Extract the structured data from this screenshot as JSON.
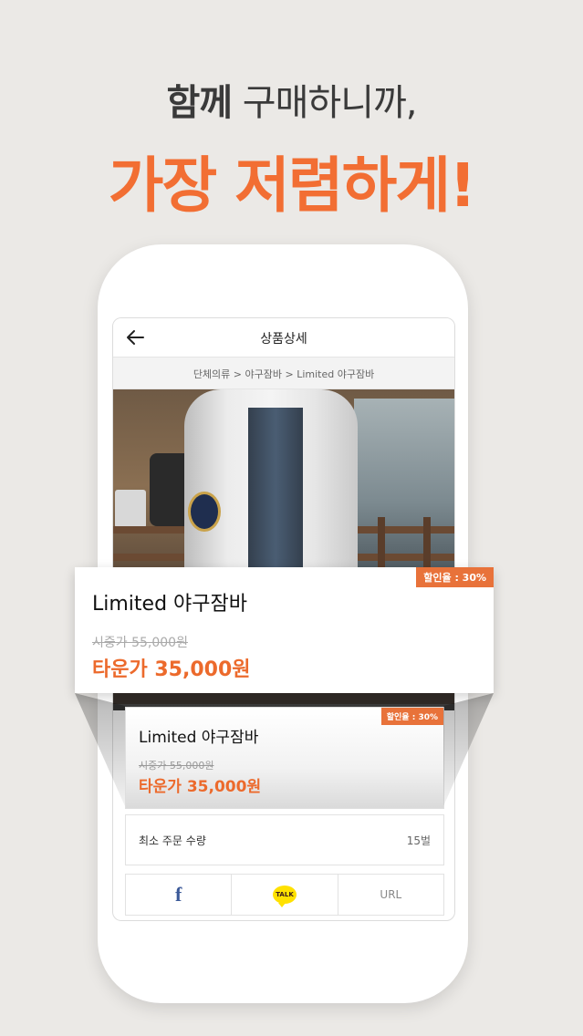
{
  "headline": {
    "line1_bold": "함께",
    "line1_rest": " 구매하니까,",
    "line2": "가장 저렴하게!"
  },
  "nav": {
    "title": "상품상세",
    "back_icon": "arrow-left-icon"
  },
  "breadcrumb": "단체의류 > 야구잠바 > Limited 야구잠바",
  "product": {
    "name": "Limited 야구잠바",
    "discount_badge": "할인율 : 30%",
    "original_price": "시중가 55,000원",
    "sale_price": "타운가 35,000원"
  },
  "small_card": {
    "discount_badge": "할인율 : 30%"
  },
  "min_order": {
    "label": "최소 주문 수량",
    "value": "15벌"
  },
  "share": {
    "facebook_label": "f",
    "kakao_label": "TALK",
    "url_label": "URL"
  },
  "colors": {
    "accent": "#f26e33",
    "background": "#ebe9e6"
  }
}
